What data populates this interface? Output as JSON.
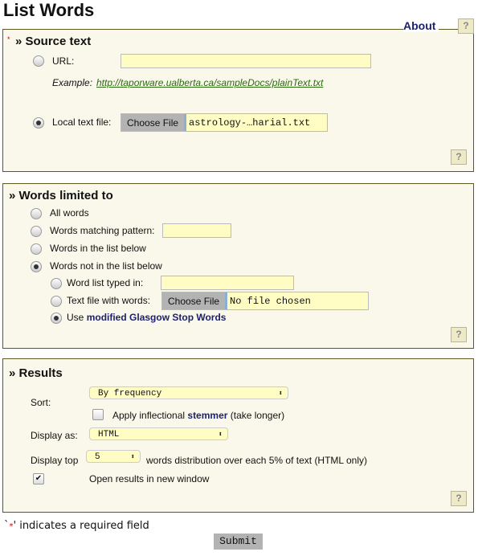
{
  "title": "List Words",
  "about": "About",
  "help": "?",
  "source": {
    "required_mark": "*",
    "heading": "» Source text",
    "url_label": "URL:",
    "url_value": "",
    "example_label": "Example:",
    "example_link": "http://taporware.ualberta.ca/sampleDocs/plainText.txt",
    "local_label": "Local text file:",
    "choose_file": "Choose File",
    "file_name": "astrology-…harial.txt",
    "selected": "local"
  },
  "words": {
    "heading": "» Words limited to",
    "options": [
      "All words",
      "Words matching pattern:",
      "Words in the list below",
      "Words not in the list below"
    ],
    "selected": "Words not in the list below",
    "sub_options": [
      "Word list typed in:",
      "Text file with words:",
      "Use "
    ],
    "glasgow_link": "modified Glasgow Stop Words",
    "choose_file": "Choose File",
    "file_name": "No file chosen"
  },
  "results": {
    "heading": "» Results",
    "sort_label": "Sort:",
    "sort_value": "By frequency",
    "stemmer_pre": "Apply inflectional ",
    "stemmer_link": "stemmer",
    "stemmer_post": " (take longer)",
    "stemmer_checked": false,
    "display_label": "Display as:",
    "display_value": "HTML",
    "top_label": "Display top",
    "top_value": "5",
    "top_suffix": "words distribution over each 5% of text (HTML only)",
    "new_window_label": "Open results in new window",
    "new_window_checked": true,
    "check_mark": "✔"
  },
  "footer": {
    "pre": "`",
    "star": "*",
    "post": "' indicates a required field",
    "submit": "Submit"
  },
  "colors": {
    "panel_bg": "#faf8ea",
    "border": "#5c5a1e",
    "input_bg": "#fffcc4",
    "link": "#1a1f6e",
    "example_link": "#2a6a10"
  }
}
